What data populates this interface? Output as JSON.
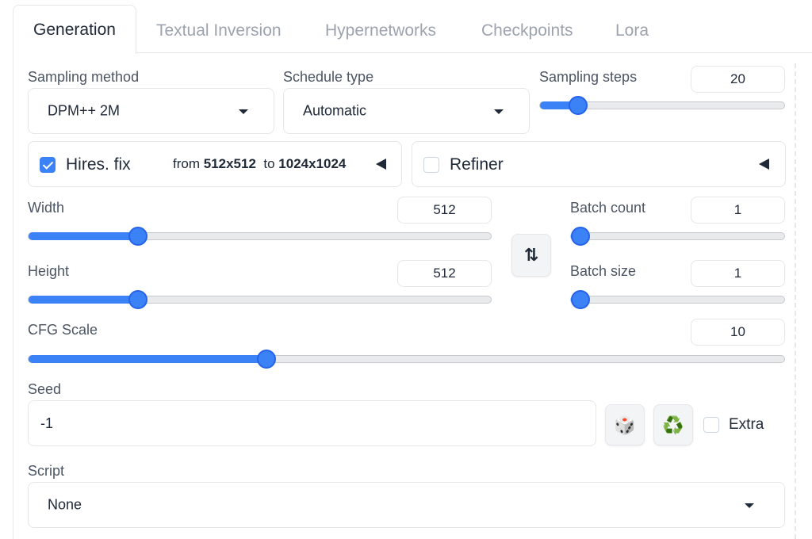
{
  "tabs": [
    {
      "label": "Generation",
      "active": true
    },
    {
      "label": "Textual Inversion"
    },
    {
      "label": "Hypernetworks"
    },
    {
      "label": "Checkpoints"
    },
    {
      "label": "Lora"
    }
  ],
  "sampling_method": {
    "label": "Sampling method",
    "value": "DPM++ 2M"
  },
  "schedule_type": {
    "label": "Schedule type",
    "value": "Automatic"
  },
  "sampling_steps": {
    "label": "Sampling steps",
    "value": "20",
    "min": 1,
    "max": 150
  },
  "hires_fix": {
    "label": "Hires. fix",
    "checked": true,
    "from_prefix": "from",
    "from_value": "512x512",
    "to_prefix": "to",
    "to_value": "1024x1024"
  },
  "refiner": {
    "label": "Refiner",
    "checked": false
  },
  "width": {
    "label": "Width",
    "value": "512",
    "min": 64,
    "max": 2048
  },
  "height": {
    "label": "Height",
    "value": "512",
    "min": 64,
    "max": 2048
  },
  "swap_icon": "⇅",
  "batch_count": {
    "label": "Batch count",
    "value": "1",
    "min": 1,
    "max": 100
  },
  "batch_size": {
    "label": "Batch size",
    "value": "1",
    "min": 1,
    "max": 8
  },
  "cfg_scale": {
    "label": "CFG Scale",
    "value": "10",
    "min": 1,
    "max": 30
  },
  "seed": {
    "label": "Seed",
    "value": "-1",
    "random_icon": "🎲",
    "reuse_icon": "♻️"
  },
  "extra": {
    "label": "Extra",
    "checked": false
  },
  "script": {
    "label": "Script",
    "value": "None"
  },
  "colors": {
    "accent": "#3b82f6",
    "border": "#e5e7eb"
  }
}
